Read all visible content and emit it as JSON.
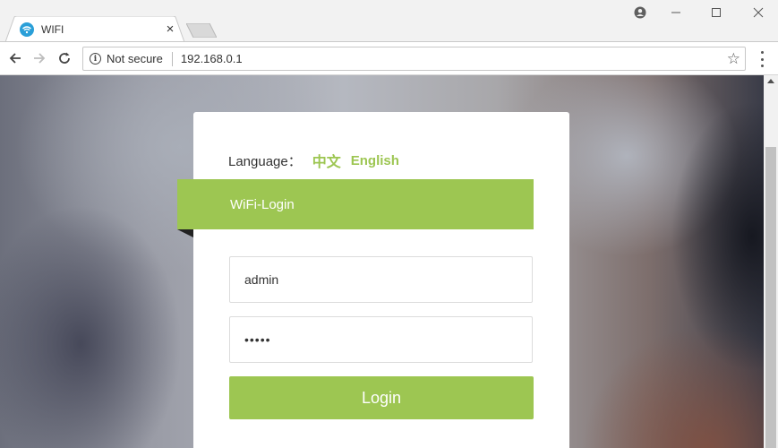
{
  "browser": {
    "tab_title": "WIFI",
    "tab_close": "×",
    "security_text": "Not secure",
    "url": "192.168.0.1",
    "favicon": "wifi-icon"
  },
  "login": {
    "language_label": "Language：",
    "lang_chinese": "中文",
    "lang_english": "English",
    "ribbon_title": "WiFi-Login",
    "username_value": "admin",
    "password_value": "•••••",
    "login_button": "Login"
  },
  "colors": {
    "accent": "#9dc652"
  }
}
